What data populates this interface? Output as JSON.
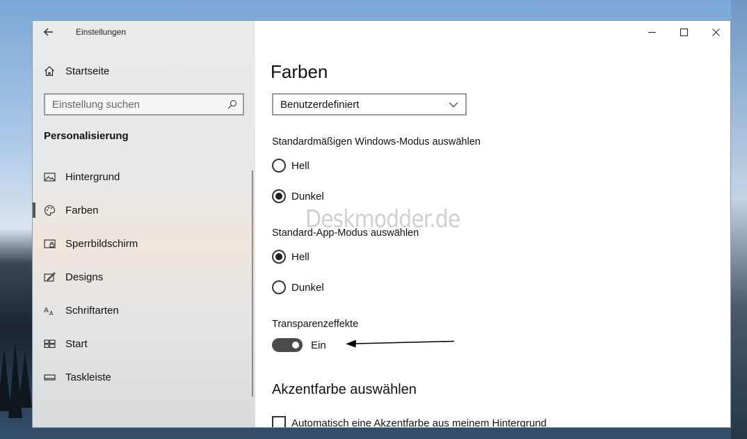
{
  "window": {
    "app_title": "Einstellungen"
  },
  "sidebar": {
    "home_label": "Startseite",
    "search_placeholder": "Einstellung suchen",
    "section_title": "Personalisierung",
    "items": [
      {
        "label": "Hintergrund",
        "icon": "image-icon",
        "active": false
      },
      {
        "label": "Farben",
        "icon": "palette-icon",
        "active": true
      },
      {
        "label": "Sperrbildschirm",
        "icon": "lock-screen-icon",
        "active": false
      },
      {
        "label": "Designs",
        "icon": "designs-icon",
        "active": false
      },
      {
        "label": "Schriftarten",
        "icon": "font-icon",
        "active": false
      },
      {
        "label": "Start",
        "icon": "start-icon",
        "active": false
      },
      {
        "label": "Taskleiste",
        "icon": "taskbar-icon",
        "active": false
      }
    ]
  },
  "content": {
    "title": "Farben",
    "color_select": {
      "value": "Benutzerdefiniert"
    },
    "windows_mode": {
      "label": "Standardmäßigen Windows-Modus auswählen",
      "options": [
        {
          "label": "Hell",
          "checked": false
        },
        {
          "label": "Dunkel",
          "checked": true
        }
      ]
    },
    "app_mode": {
      "label": "Standard-App-Modus auswählen",
      "options": [
        {
          "label": "Hell",
          "checked": true
        },
        {
          "label": "Dunkel",
          "checked": false
        }
      ]
    },
    "transparency": {
      "label": "Transparenzeffekte",
      "state_label": "Ein",
      "on": true
    },
    "accent": {
      "heading": "Akzentfarbe auswählen",
      "auto_label": "Automatisch eine Akzentfarbe aus meinem Hintergrund",
      "auto_checked": false
    },
    "watermark": "Deskmodder.de"
  },
  "colors": {
    "text": "#111111",
    "toggle_on": "#4b4b4b",
    "control_border": "#9a9a9a"
  }
}
